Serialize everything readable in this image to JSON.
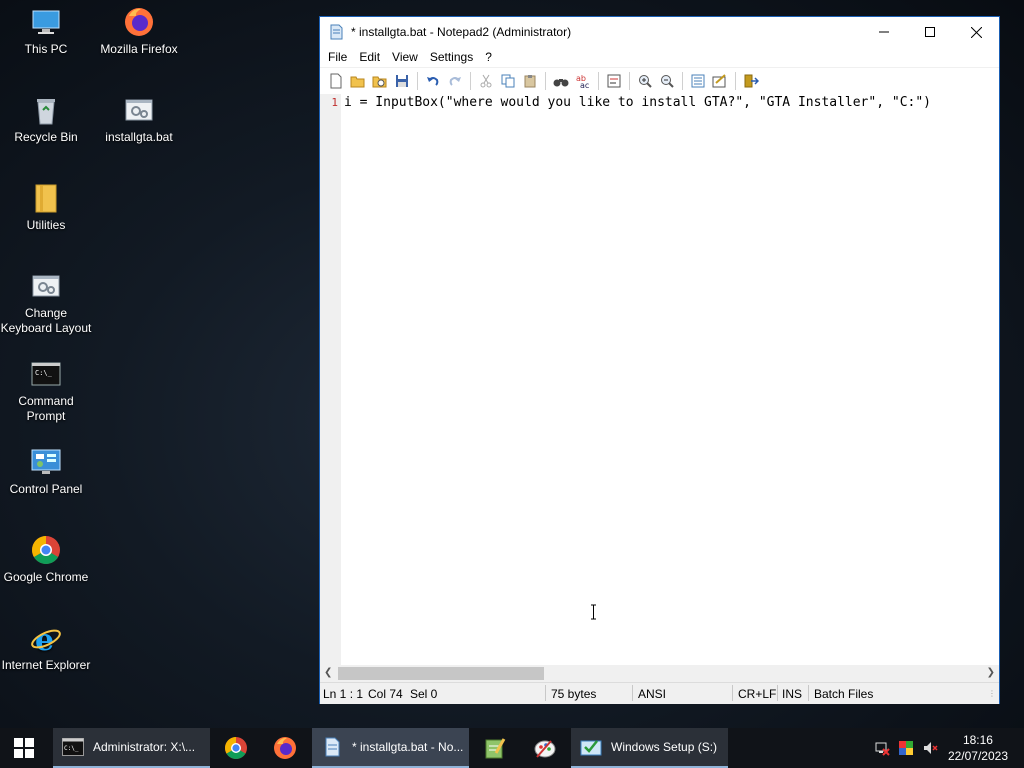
{
  "desktop": {
    "icons": [
      {
        "label": "This PC",
        "icon": "this-pc-icon"
      },
      {
        "label": "Mozilla Firefox",
        "icon": "firefox-icon"
      },
      {
        "label": "Recycle Bin",
        "icon": "recycle-bin-icon"
      },
      {
        "label": "installgta.bat",
        "icon": "batch-file-icon"
      },
      {
        "label": "Utilities",
        "icon": "folder-icon"
      },
      {
        "label": "Change\nKeyboard Layout",
        "icon": "keyboard-layout-icon"
      },
      {
        "label": "Command\nPrompt",
        "icon": "command-prompt-icon"
      },
      {
        "label": "Control Panel",
        "icon": "control-panel-icon"
      },
      {
        "label": "Google Chrome",
        "icon": "chrome-icon"
      },
      {
        "label": "Internet Explorer",
        "icon": "internet-explorer-icon"
      }
    ]
  },
  "window": {
    "title": "* installgta.bat - Notepad2 (Administrator)",
    "menu": [
      "File",
      "Edit",
      "View",
      "Settings",
      "?"
    ],
    "editor": {
      "line_number": "1",
      "code": "i = InputBox(\"where would you like to install GTA?\", \"GTA Installer\", \"C:\")"
    },
    "status": {
      "position": "Ln 1 : 1",
      "column": "Col 74",
      "selection": "Sel 0",
      "size": "75 bytes",
      "encoding": "ANSI",
      "line_endings": "CR+LF",
      "mode": "INS",
      "scheme": "Batch Files"
    }
  },
  "taskbar": {
    "items": [
      {
        "label": "Administrator: X:\\...",
        "icon": "command-prompt-icon"
      },
      {
        "label": "",
        "icon": "chrome-icon"
      },
      {
        "label": "",
        "icon": "firefox-icon"
      },
      {
        "label": "* installgta.bat - No...",
        "icon": "notepad2-icon"
      },
      {
        "label": "",
        "icon": "notepad-edit-icon"
      },
      {
        "label": "",
        "icon": "paint-icon"
      },
      {
        "label": "Windows Setup (S:)",
        "icon": "windows-setup-icon"
      }
    ],
    "time": "18:16",
    "date": "22/07/2023"
  },
  "colors": {
    "accent": "#1a5fb4",
    "line_number": "#c0302f",
    "taskbar": "#101318"
  }
}
